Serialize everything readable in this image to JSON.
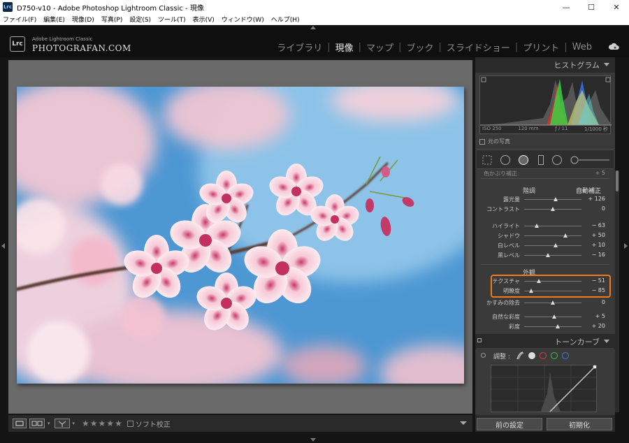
{
  "window": {
    "title": "D750-v10 - Adobe Photoshop Lightroom Classic - 現像",
    "app_icon": "Lrc",
    "minimize": "—",
    "maximize": "☐",
    "close": "✕"
  },
  "menu": [
    "ファイル(F)",
    "編集(E)",
    "現像(D)",
    "写真(P)",
    "設定(S)",
    "ツール(T)",
    "表示(V)",
    "ウィンドウ(W)",
    "ヘルプ(H)"
  ],
  "brand": {
    "logo": "Lrc",
    "sub": "Adobe Lightroom Classic",
    "main": "PHOTOGRAFAN.COM"
  },
  "modules": [
    {
      "label": "ライブラリ",
      "active": false
    },
    {
      "label": "現像",
      "active": true
    },
    {
      "label": "マップ",
      "active": false
    },
    {
      "label": "ブック",
      "active": false
    },
    {
      "label": "スライドショー",
      "active": false
    },
    {
      "label": "プリント",
      "active": false
    },
    {
      "label": "Web",
      "active": false
    }
  ],
  "histogram": {
    "header": "ヒストグラム",
    "iso": "ISO 250",
    "focal": "120 mm",
    "aperture": "ƒ / 11",
    "shutter": "1/1000 秒",
    "original_photo": "元の写真"
  },
  "basic": {
    "cut_label": "色かぶり補正",
    "cut_value": "+ 5",
    "tone_title": "階調",
    "auto_label": "自動補正",
    "tone": [
      {
        "label": "露光量",
        "value": "+ 126",
        "pos": 0.55
      },
      {
        "label": "コントラスト",
        "value": "0",
        "pos": 0.5
      }
    ],
    "tone2": [
      {
        "label": "ハイライト",
        "value": "− 63",
        "pos": 0.22
      },
      {
        "label": "シャドウ",
        "value": "+ 50",
        "pos": 0.72
      },
      {
        "label": "白レベル",
        "value": "+ 10",
        "pos": 0.55
      },
      {
        "label": "黒レベル",
        "value": "− 16",
        "pos": 0.42
      }
    ],
    "presence_title": "外観",
    "presence": [
      {
        "label": "テクスチャ",
        "value": "− 51",
        "pos": 0.25
      },
      {
        "label": "明瞭度",
        "value": "− 85",
        "pos": 0.12
      },
      {
        "label": "かすみの除去",
        "value": "0",
        "pos": 0.5
      },
      {
        "label": "自然な彩度",
        "value": "+ 5",
        "pos": 0.52
      },
      {
        "label": "彩度",
        "value": "+ 20",
        "pos": 0.58
      }
    ]
  },
  "tone_curve": {
    "header": "トーンカーブ",
    "adjust_label": "調整 :"
  },
  "buttons": {
    "previous": "前の設定",
    "reset": "初期化"
  },
  "toolbar": {
    "stars": "★★★★★",
    "soft_proof": "ソフト校正"
  },
  "colors": {
    "highlight": "#ef7b1c"
  }
}
